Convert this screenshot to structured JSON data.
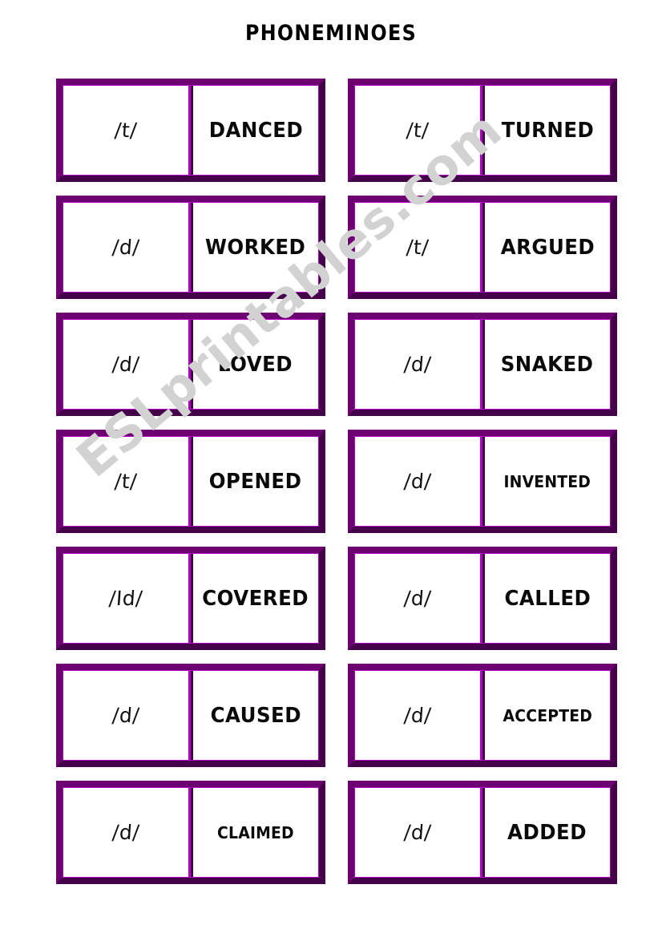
{
  "page": {
    "title": "PHONEMINOES",
    "watermark": "ESLprintables.com",
    "colors": {
      "border_outer_dark": "#45004a",
      "border_outer_light": "#6c0070",
      "border_inner_bright": "#b400c8",
      "text": "#0a0a0a",
      "background": "#ffffff",
      "watermark": "#d2d2d2"
    }
  },
  "dominoes": {
    "left_column": [
      {
        "sound": "/t/",
        "word": "DANCED",
        "word_size": "normal"
      },
      {
        "sound": "/d/",
        "word": "WORKED",
        "word_size": "normal"
      },
      {
        "sound": "/d/",
        "word": "LOVED",
        "word_size": "normal"
      },
      {
        "sound": "/t/",
        "word": "OPENED",
        "word_size": "normal"
      },
      {
        "sound": "/Id/",
        "word": "COVERED",
        "word_size": "normal"
      },
      {
        "sound": "/d/",
        "word": "CAUSED",
        "word_size": "normal"
      },
      {
        "sound": "/d/",
        "word": "CLAIMED",
        "word_size": "small"
      }
    ],
    "right_column": [
      {
        "sound": "/t/",
        "word": "TURNED",
        "word_size": "normal"
      },
      {
        "sound": "/t/",
        "word": "ARGUED",
        "word_size": "normal"
      },
      {
        "sound": "/d/",
        "word": "SNAKED",
        "word_size": "normal"
      },
      {
        "sound": "/d/",
        "word": "INVENTED",
        "word_size": "small"
      },
      {
        "sound": "/d/",
        "word": "CALLED",
        "word_size": "normal"
      },
      {
        "sound": "/d/",
        "word": "ACCEPTED",
        "word_size": "small"
      },
      {
        "sound": "/d/",
        "word": "ADDED",
        "word_size": "normal"
      }
    ]
  }
}
